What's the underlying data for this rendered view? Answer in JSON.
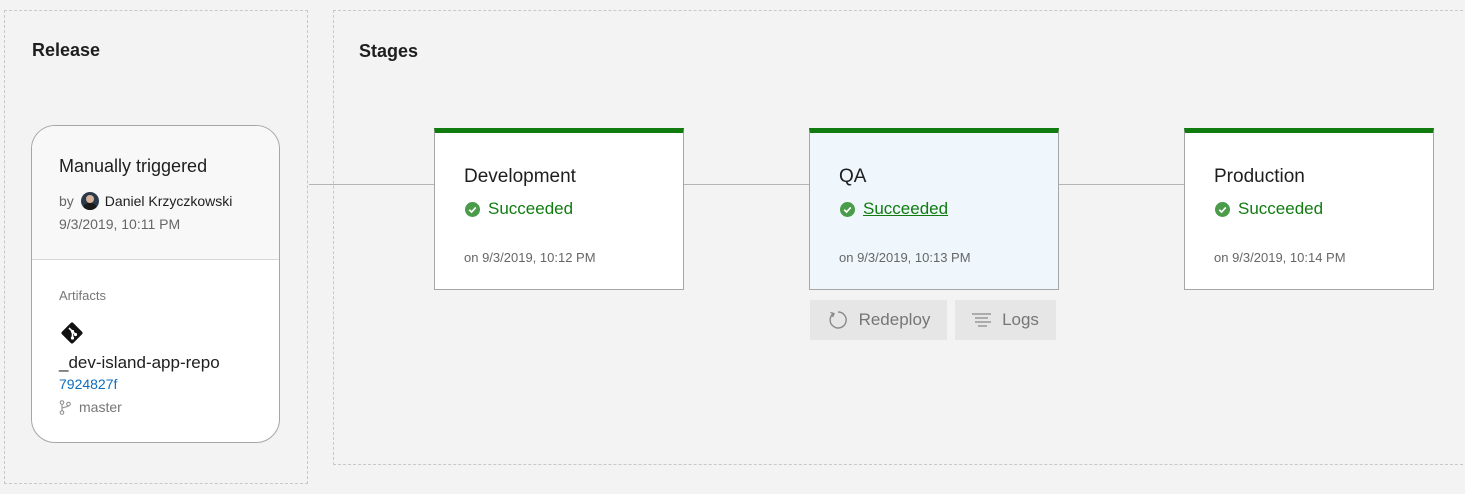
{
  "release": {
    "section_title": "Release",
    "trigger_title": "Manually triggered",
    "by_label": "by",
    "author": "Daniel Krzyczkowski",
    "date": "9/3/2019, 10:11 PM",
    "artifacts_label": "Artifacts",
    "artifact": {
      "name": "_dev-island-app-repo",
      "commit": "7924827f",
      "branch": "master"
    }
  },
  "stages": {
    "section_title": "Stages",
    "items": [
      {
        "name": "Development",
        "status": "Succeeded",
        "date": "on 9/3/2019, 10:12 PM"
      },
      {
        "name": "QA",
        "status": "Succeeded",
        "date": "on 9/3/2019, 10:13 PM"
      },
      {
        "name": "Production",
        "status": "Succeeded",
        "date": "on 9/3/2019, 10:14 PM"
      }
    ],
    "actions": {
      "redeploy_label": "Redeploy",
      "logs_label": "Logs"
    }
  },
  "colors": {
    "success": "#107c10",
    "check": "#4a9c4a",
    "link": "#106ebe",
    "selected_bg": "#eff6fc"
  }
}
